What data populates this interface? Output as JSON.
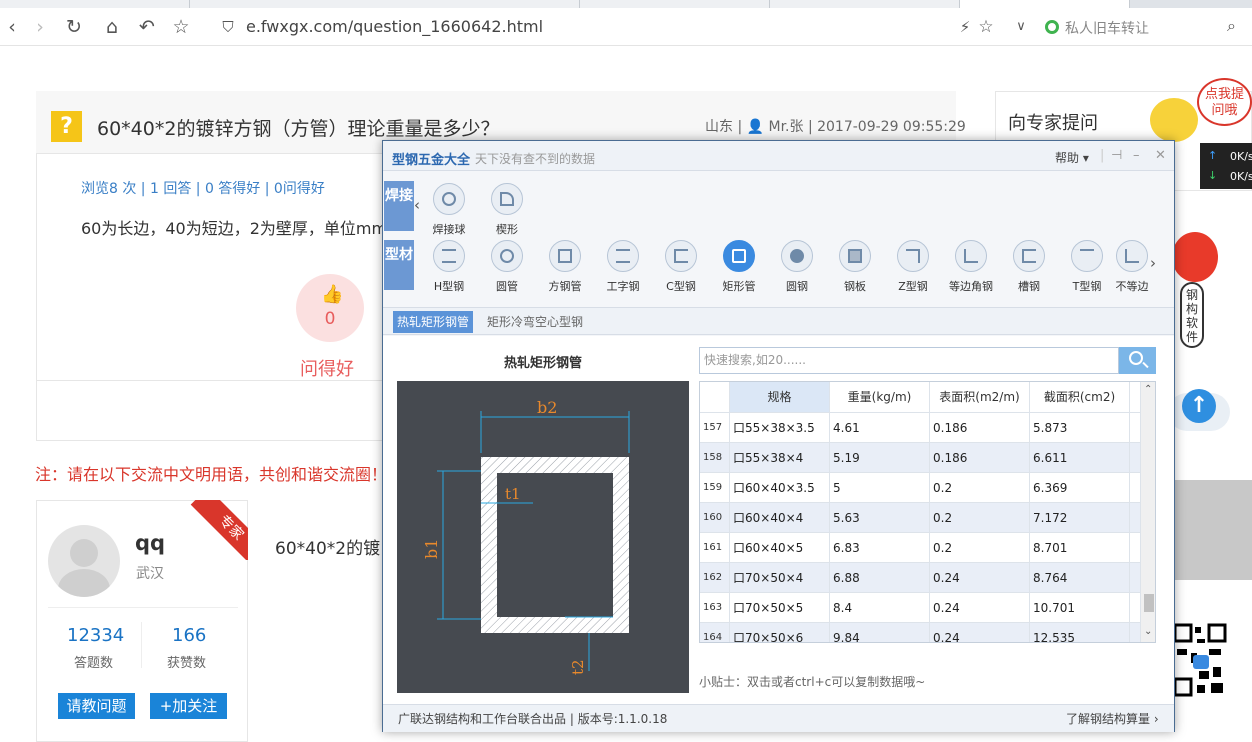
{
  "browser": {
    "url": "e.fwxgx.com/question_1660642.html",
    "search_placeholder": "私人旧车转让"
  },
  "question": {
    "title": "60*40*2的镀锌方钢（方管）理论重量是多少？",
    "meta": "山东 | 👤 Mr.张 | 2017-09-29 09:55:29",
    "stats": "浏览8 次 | 1 回答 | 0 答得好 | 0问得好",
    "body": "60为长边，40为短边，2为壁厚，单位mm",
    "like_count": "0",
    "like_label": "问得好"
  },
  "notice": "注：请在以下交流中文明用语，共创和谐交流圈！",
  "user": {
    "name": "qq",
    "city": "武汉",
    "badge": "专家",
    "answers": "12334",
    "answers_label": "答题数",
    "likes": "166",
    "likes_label": "获赞数",
    "ask_button": "请教问题",
    "follow_button": "+加关注"
  },
  "answer_preview": "60*40*2的镀",
  "sidebar": {
    "title": "向专家提问",
    "bubble": "点我提问哦",
    "speed_up": "0K/s",
    "speed_down": "0K/s"
  },
  "popup": {
    "app_name": "型钢五金大全",
    "subtitle": "天下没有查不到的数据",
    "help": "帮助",
    "categories": [
      {
        "label": "焊接",
        "tools": [
          "焊接球",
          "楔形"
        ]
      },
      {
        "label": "型材",
        "tools": [
          "H型钢",
          "圆管",
          "方钢管",
          "工字钢",
          "C型钢",
          "矩形管",
          "圆钢",
          "钢板",
          "Z型钢",
          "等边角钢",
          "槽钢",
          "T型钢",
          "不等边"
        ]
      }
    ],
    "active_tool": "矩形管",
    "subtabs": [
      "热轧矩形钢管",
      "矩形冷弯空心型钢"
    ],
    "active_subtab": "热轧矩形钢管",
    "figure_title": "热轧矩形钢管",
    "figure_labels": {
      "b2": "b2",
      "b1": "b1",
      "t1": "t1",
      "t2": "t2"
    },
    "search_placeholder": "快速搜索,如20......",
    "table": {
      "headers": [
        "规格",
        "重量(kg/m)",
        "表面积(m2/m)",
        "截面积(cm2)"
      ],
      "rows": [
        {
          "idx": "157",
          "spec": "口55×38×3.5",
          "weight": "4.61",
          "surface": "0.186",
          "area": "5.873"
        },
        {
          "idx": "158",
          "spec": "口55×38×4",
          "weight": "5.19",
          "surface": "0.186",
          "area": "6.611"
        },
        {
          "idx": "159",
          "spec": "口60×40×3.5",
          "weight": "5",
          "surface": "0.2",
          "area": "6.369"
        },
        {
          "idx": "160",
          "spec": "口60×40×4",
          "weight": "5.63",
          "surface": "0.2",
          "area": "7.172"
        },
        {
          "idx": "161",
          "spec": "口60×40×5",
          "weight": "6.83",
          "surface": "0.2",
          "area": "8.701"
        },
        {
          "idx": "162",
          "spec": "口70×50×4",
          "weight": "6.88",
          "surface": "0.24",
          "area": "8.764"
        },
        {
          "idx": "163",
          "spec": "口70×50×5",
          "weight": "8.4",
          "surface": "0.24",
          "area": "10.701"
        },
        {
          "idx": "164",
          "spec": "口70×50×6",
          "weight": "9.84",
          "surface": "0.24",
          "area": "12.535"
        }
      ]
    },
    "tip": "小贴士：双击或者ctrl+c可以复制数据哦~",
    "footer_left": "广联达钢结构和工作台联合出品",
    "version": "版本号:1.1.0.18",
    "footer_right": "了解钢结构算量"
  },
  "colors": {
    "accent": "#3a8ae0",
    "red": "#d9362b",
    "link": "#3a7fc6"
  }
}
